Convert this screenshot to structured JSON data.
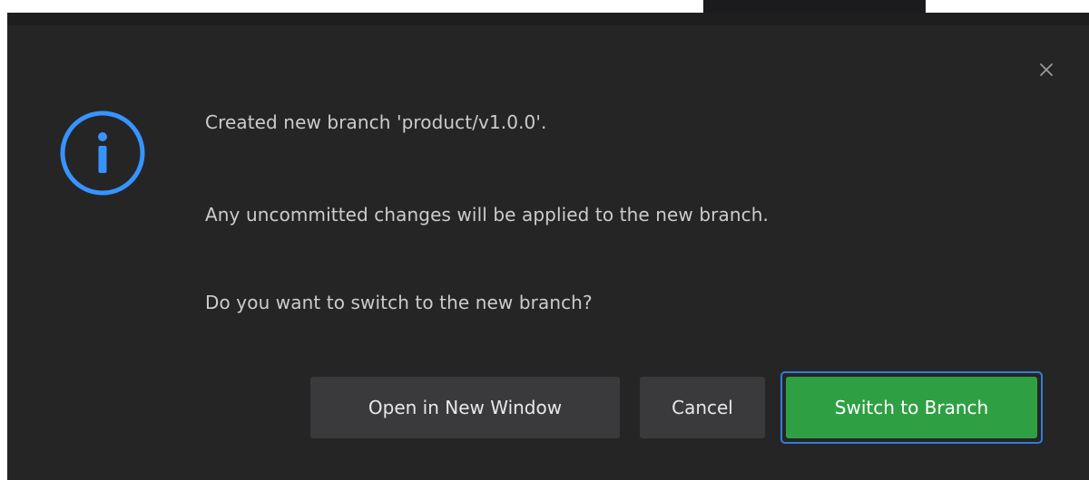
{
  "dialog": {
    "messages": [
      "Created new branch 'product/v1.0.0'.",
      "Any uncommitted changes will be applied to the new branch.",
      "Do you want to switch to the new branch?"
    ],
    "buttons": {
      "open_new_window": "Open in New Window",
      "cancel": "Cancel",
      "switch_to_branch": "Switch to Branch"
    },
    "close_glyph": "×",
    "icon": "info-icon"
  },
  "colors": {
    "background": "#252526",
    "info_accent": "#3794ff",
    "primary_button": "#2ea043",
    "focus_ring": "#2f7fd6",
    "secondary_button": "#3a3a3c"
  }
}
